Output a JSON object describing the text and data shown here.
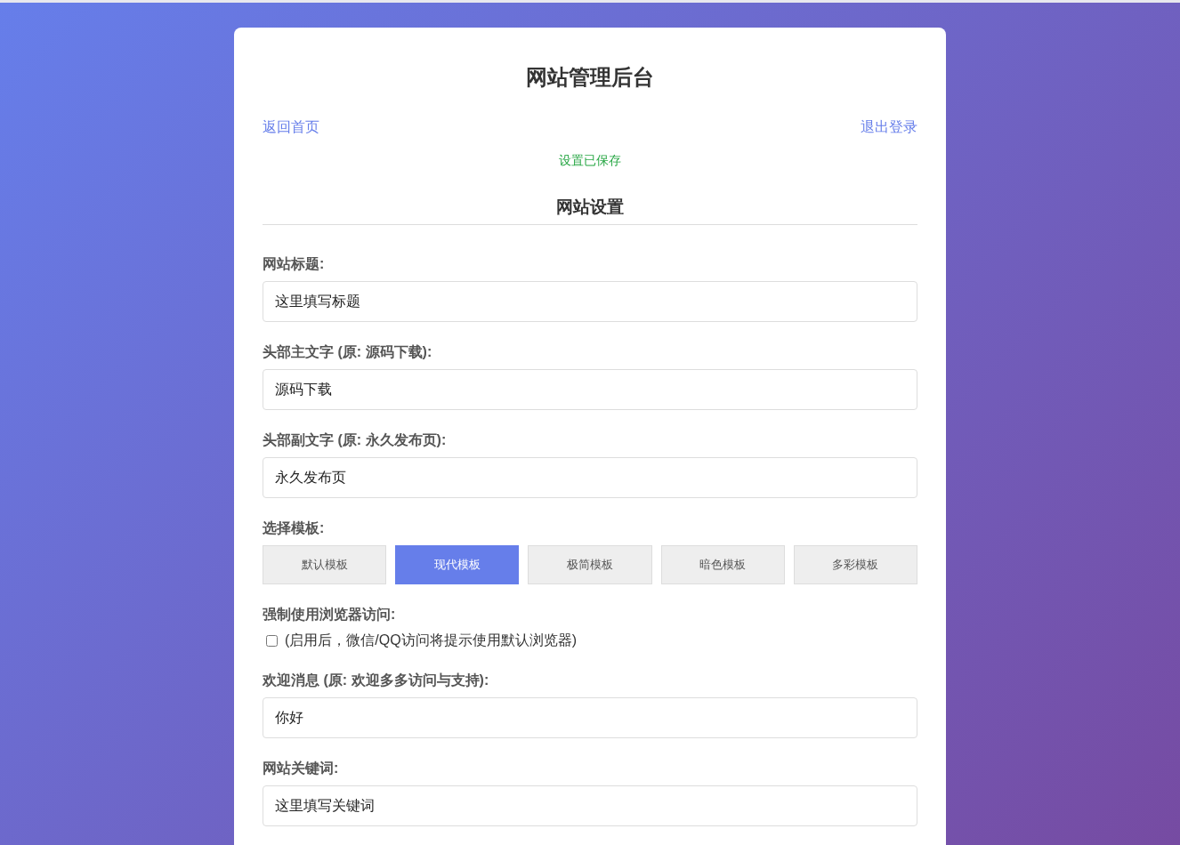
{
  "title": "网站管理后台",
  "nav": {
    "home": "返回首页",
    "logout": "退出登录"
  },
  "message": "设置已保存",
  "section_title": "网站设置",
  "fields": [
    {
      "kind": "text",
      "label": "网站标题:",
      "value": "这里填写标题"
    },
    {
      "kind": "text",
      "label": "头部主文字 (原: 源码下载):",
      "value": "源码下载"
    },
    {
      "kind": "text",
      "label": "头部副文字 (原: 永久发布页):",
      "value": "永久发布页"
    },
    {
      "kind": "templates",
      "label": "选择模板:",
      "options": [
        {
          "label": "默认模板",
          "selected": false
        },
        {
          "label": "现代模板",
          "selected": true
        },
        {
          "label": "极简模板",
          "selected": false
        },
        {
          "label": "暗色模板",
          "selected": false
        },
        {
          "label": "多彩模板",
          "selected": false
        }
      ]
    },
    {
      "kind": "checkbox",
      "label": "强制使用浏览器访问:",
      "checked": false,
      "hint": "(启用后，微信/QQ访问将提示使用默认浏览器)"
    },
    {
      "kind": "text",
      "label": "欢迎消息 (原: 欢迎多多访问与支持):",
      "value": "你好"
    },
    {
      "kind": "text",
      "label": "网站关键词:",
      "value": "这里填写关键词"
    }
  ]
}
